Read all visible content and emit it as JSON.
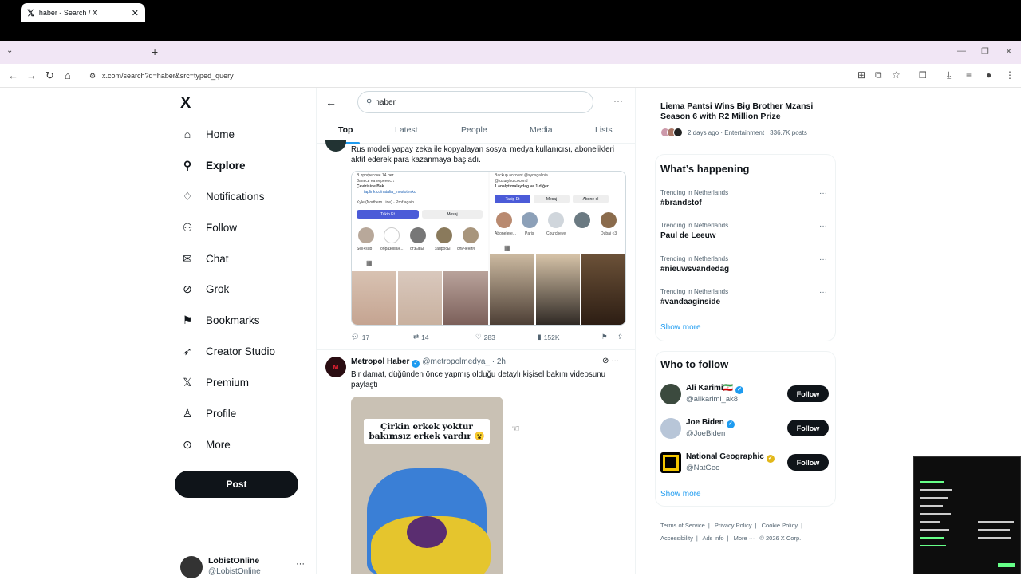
{
  "browser": {
    "tab_title": "haber - Search / X",
    "tab_icon": "x-logo-icon",
    "url": "x.com/search?q=haber&src=typed_query"
  },
  "nav": {
    "logo": "X",
    "items": [
      {
        "label": "Home",
        "icon": "home-icon"
      },
      {
        "label": "Explore",
        "icon": "search-icon",
        "active": true
      },
      {
        "label": "Notifications",
        "icon": "bell-icon"
      },
      {
        "label": "Follow",
        "icon": "person-plus-icon"
      },
      {
        "label": "Chat",
        "icon": "mail-icon"
      },
      {
        "label": "Grok",
        "icon": "grok-icon"
      },
      {
        "label": "Bookmarks",
        "icon": "bookmark-icon"
      },
      {
        "label": "Creator Studio",
        "icon": "rocket-icon"
      },
      {
        "label": "Premium",
        "icon": "x-icon"
      },
      {
        "label": "Profile",
        "icon": "person-icon"
      },
      {
        "label": "More",
        "icon": "more-circle-icon"
      }
    ],
    "post_label": "Post",
    "account": {
      "name": "LobistOnline",
      "handle": "@LobistOnline"
    }
  },
  "search": {
    "query": "haber",
    "tabs": [
      "Top",
      "Latest",
      "People",
      "Media",
      "Lists"
    ],
    "active_tab": "Top"
  },
  "tweet1": {
    "text": "Rus modeli yapay zeka ile kopyalayan sosyal medya kullanıcısı, abonelikleri aktif ederek para kazanmaya başladı.",
    "media_left": {
      "line1": "В профессии 14 лет",
      "line2": "Запись на перенос ↓",
      "line3": "Çevirisine Bak",
      "link": "taplink.cc/natalia_mostotenko",
      "name": "Kyle (Northern Line) · Prof again...",
      "follow": "Takip Et",
      "message": "Mesaj",
      "highlights": [
        "Sell+sub",
        "образован...",
        "отзывы",
        "запросы",
        "сличения"
      ]
    },
    "media_right": {
      "line1": "Backup account @sydsgalinia",
      "line2": "@luxurybutcocond",
      "line3": "1.analytimalaydag ve 1 diğer",
      "follow": "Takip Et",
      "message": "Mesaj",
      "subscribe": "Abone ol",
      "highlights": [
        "Abonelere...",
        "Paris",
        "Courchevel",
        "",
        "Dubai <3"
      ]
    },
    "replies": "17",
    "reposts": "14",
    "likes": "283",
    "views": "152K"
  },
  "tweet2": {
    "name": "Metropol Haber",
    "handle": "@metropolmedya_",
    "time": "2h",
    "text": "Bir damat, düğünden önce yapmış olduğu detaylı kişisel bakım videosunu paylaştı",
    "caption_line1": "Çirkin erkek yoktur",
    "caption_line2": "bakımsız erkek vardır 😮"
  },
  "sidebar": {
    "news_title": "Liema Pantsi Wins Big Brother Mzansi Season 6 with R2 Million Prize",
    "news_meta": "2 days ago · Entertainment · 336.7K posts",
    "whats_happening": "What’s happening",
    "trends": [
      {
        "context": "Trending in Netherlands",
        "tag": "#brandstof"
      },
      {
        "context": "Trending in Netherlands",
        "tag": "Paul de Leeuw"
      },
      {
        "context": "Trending in Netherlands",
        "tag": "#nieuwsvandedag"
      },
      {
        "context": "Trending in Netherlands",
        "tag": "#vandaaginside"
      }
    ],
    "show_more": "Show more",
    "who_to_follow": "Who to follow",
    "follow_label": "Follow",
    "accounts": [
      {
        "name": "Ali Karimi🇮🇷",
        "handle": "@alikarimi_ak8",
        "badge": "blue"
      },
      {
        "name": "Joe Biden",
        "handle": "@JoeBiden",
        "badge": "blue"
      },
      {
        "name": "National Geographic",
        "handle": "@NatGeo",
        "badge": "gold"
      }
    ],
    "footer": [
      "Terms of Service",
      "Privacy Policy",
      "Cookie Policy",
      "Accessibility",
      "Ads info",
      "More ···",
      "© 2026 X Corp."
    ]
  },
  "colors": {
    "accent": "#1d9bf0",
    "text": "#0f1419",
    "muted": "#536471",
    "tabstrip": "#f1e6f5"
  }
}
